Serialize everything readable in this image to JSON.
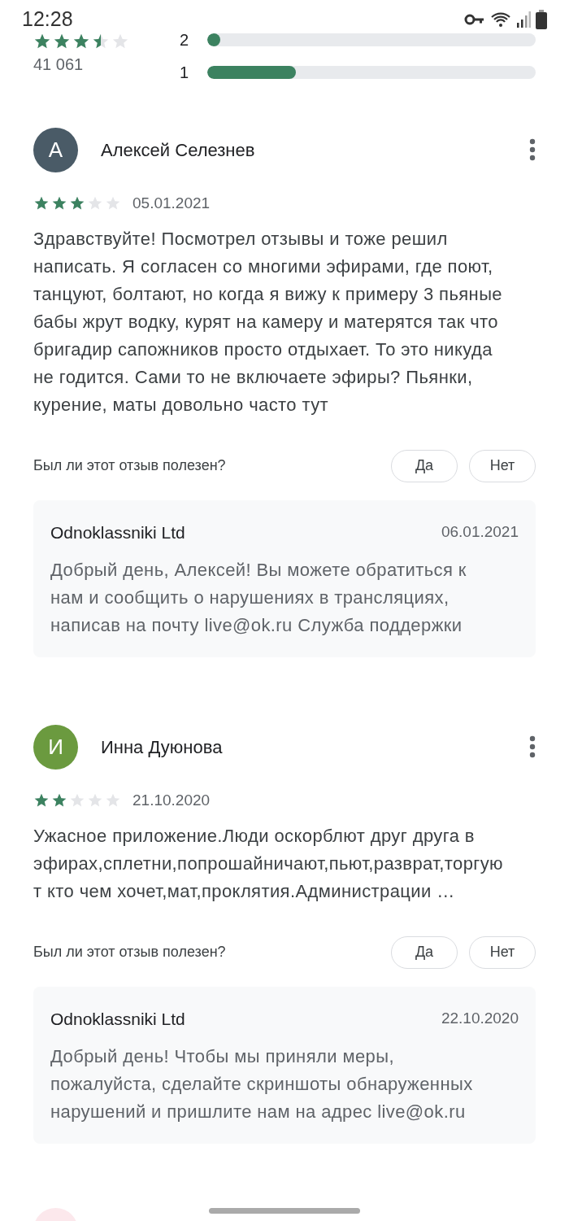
{
  "status_bar": {
    "time": "12:28"
  },
  "summary": {
    "stars": 3.5,
    "count": "41 061",
    "bars": [
      {
        "label": "2",
        "level": 0.03
      },
      {
        "label": "1",
        "level": 0.27
      }
    ]
  },
  "reviews": [
    {
      "initial": "А",
      "color": "#4a5b67",
      "name": "Алексей Селезнев",
      "stars": 3,
      "date": "05.01.2021",
      "text": "Здравствуйте! Посмотрел отзывы и тоже решил написать. Я согласен со многими эфирами, где поют, танцуют, болтают, но когда я вижу к примеру 3 пьяные бабы жрут водку, курят на камеру и матерятся так что бригадир сапожников просто отдыхает. То это никуда не годится. Сами то не включаете эфиры? Пьянки, курение, маты довольно часто тут",
      "helpful_prompt": "Был ли этот отзыв полезен?",
      "yes": "Да",
      "no": "Нет",
      "reply": {
        "author": "Odnoklassniki Ltd",
        "date": "06.01.2021",
        "text": "Добрый день, Алексей! Вы можете обратиться к нам и сообщить о нарушениях в трансляциях, написав на почту live@ok.ru Служба поддержки"
      }
    },
    {
      "initial": "И",
      "color": "#6b9a3f",
      "name": "Инна Дуюнова",
      "stars": 2,
      "date": "21.10.2020",
      "text": "Ужасное приложение.Люди оскорблют друг друга в эфирах,сплетни,попрошайничают,пьют,разврат,торгуют кто чем хочет,мат,проклятия.Администрации …",
      "helpful_prompt": "Был ли этот отзыв полезен?",
      "yes": "Да",
      "no": "Нет",
      "reply": {
        "author": "Odnoklassniki Ltd",
        "date": "22.10.2020",
        "text": "Добрый день! Чтобы мы приняли меры, пожалуйста, сделайте скриншоты обнаруженных нарушений и пришлите нам на адрес live@ok.ru"
      }
    }
  ],
  "next_review": {
    "color": "#fce8ec"
  }
}
